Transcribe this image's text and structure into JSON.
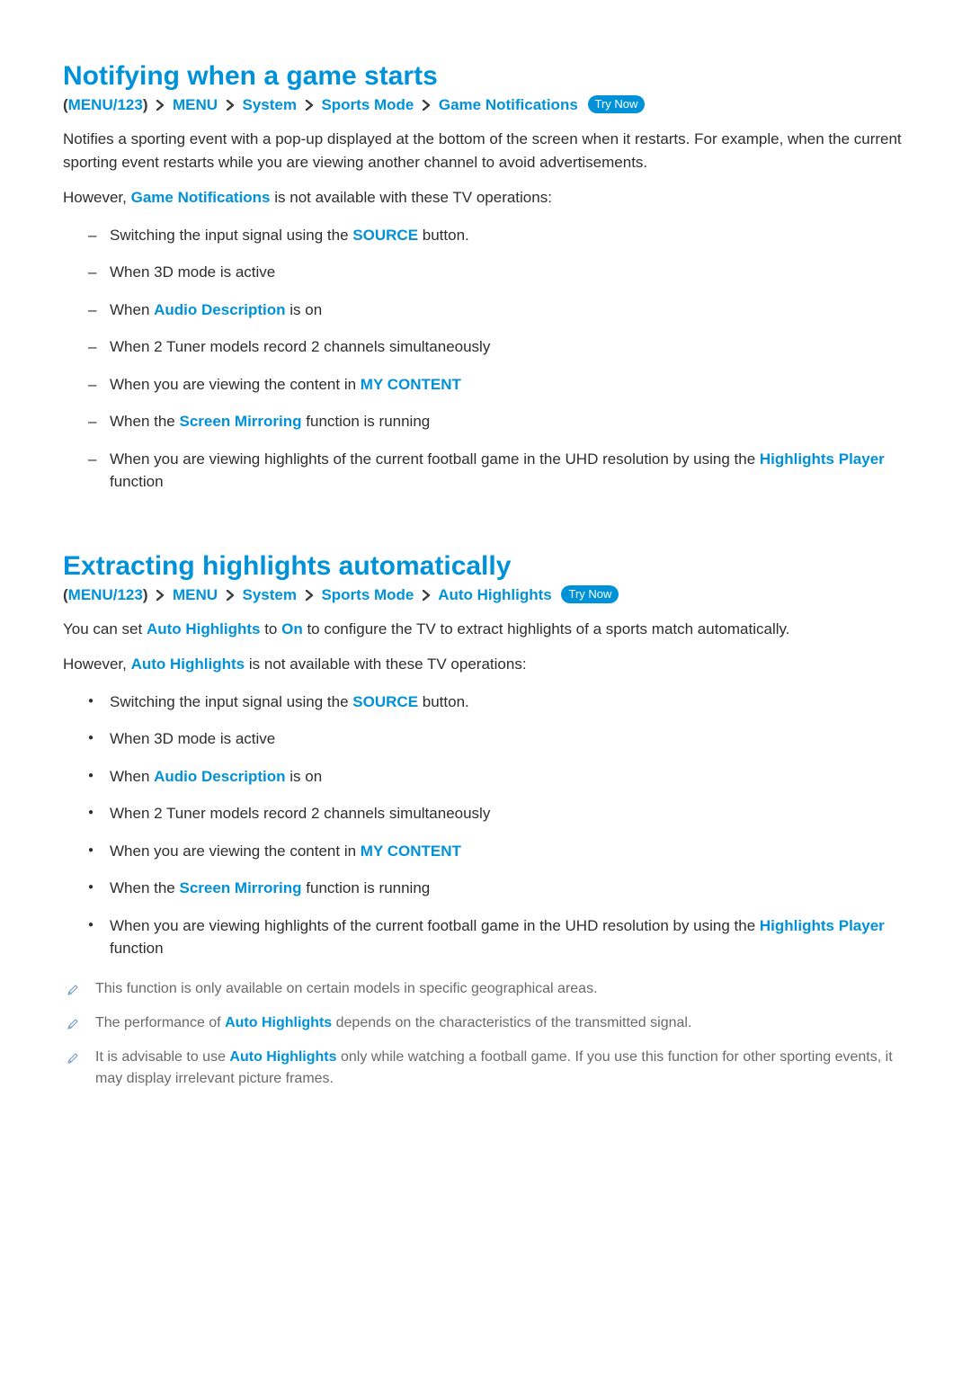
{
  "section1": {
    "title": "Notifying when a game starts",
    "breadcrumb": {
      "bc0": "MENU/123",
      "bc1": "MENU",
      "bc2": "System",
      "bc3": "Sports Mode",
      "bc4": "Game Notifications",
      "try_now": "Try Now"
    },
    "para1": "Notifies a sporting event with a pop-up displayed at the bottom of the screen when it restarts. For example, when the current sporting event restarts while you are viewing another channel to avoid advertisements.",
    "para2_pre": "However, ",
    "para2_hl": "Game Notifications",
    "para2_post": " is not available with these TV operations:",
    "items": {
      "i1_pre": "Switching the input signal using the ",
      "i1_hl": "SOURCE",
      "i1_post": " button.",
      "i2": "When 3D mode is active",
      "i3_pre": "When ",
      "i3_hl": "Audio Description",
      "i3_post": " is on",
      "i4": "When 2 Tuner models record 2 channels simultaneously",
      "i5_pre": "When you are viewing the content in ",
      "i5_hl": "MY CONTENT",
      "i6_pre": "When the ",
      "i6_hl": "Screen Mirroring",
      "i6_post": " function is running",
      "i7_pre": "When you are viewing highlights of the current football game in the UHD resolution by using the ",
      "i7_hl": "Highlights Player",
      "i7_post": " function"
    }
  },
  "section2": {
    "title": "Extracting highlights automatically",
    "breadcrumb": {
      "bc0": "MENU/123",
      "bc1": "MENU",
      "bc2": "System",
      "bc3": "Sports Mode",
      "bc4": "Auto Highlights",
      "try_now": "Try Now"
    },
    "para1_pre": "You can set ",
    "para1_hl1": "Auto Highlights",
    "para1_mid": " to ",
    "para1_hl2": "On",
    "para1_post": " to configure the TV to extract highlights of a sports match automatically.",
    "para2_pre": "However, ",
    "para2_hl": "Auto Highlights",
    "para2_post": " is not available with these TV operations:",
    "items": {
      "i1_pre": "Switching the input signal using the ",
      "i1_hl": "SOURCE",
      "i1_post": " button.",
      "i2": "When 3D mode is active",
      "i3_pre": "When ",
      "i3_hl": "Audio Description",
      "i3_post": " is on",
      "i4": "When 2 Tuner models record 2 channels simultaneously",
      "i5_pre": "When you are viewing the content in ",
      "i5_hl": "MY CONTENT",
      "i6_pre": "When the ",
      "i6_hl": "Screen Mirroring",
      "i6_post": " function is running",
      "i7_pre": "When you are viewing highlights of the current football game in the UHD resolution by using the ",
      "i7_hl": "Highlights Player",
      "i7_post": " function"
    },
    "notes": {
      "n1": "This function is only available on certain models in specific geographical areas.",
      "n2_pre": "The performance of ",
      "n2_hl": "Auto Highlights",
      "n2_post": " depends on the characteristics of the transmitted signal.",
      "n3_pre": "It is advisable to use ",
      "n3_hl": "Auto Highlights",
      "n3_post": " only while watching a football game. If you use this function for other sporting events, it may display irrelevant picture frames."
    }
  }
}
